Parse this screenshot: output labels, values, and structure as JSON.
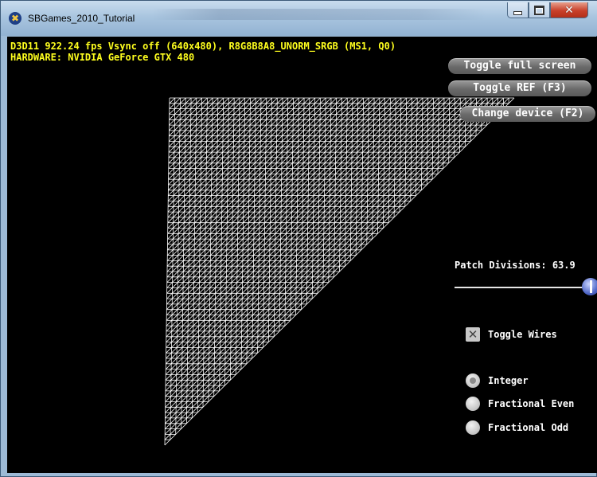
{
  "window": {
    "title": "SBGames_2010_Tutorial",
    "controls": {
      "close_glyph": "✕"
    }
  },
  "hud": {
    "line1": "D3D11 922.24 fps Vsync off (640x480), R8G8B8A8_UNORM_SRGB (MS1, Q0)",
    "line2": "HARDWARE: NVIDIA GeForce GTX 480"
  },
  "buttons": {
    "toggle_full_screen": "Toggle full screen",
    "toggle_ref": "Toggle REF (F3)",
    "change_device": "Change device (F2)"
  },
  "tessellation": {
    "patch_divisions_label": "Patch Divisions: 63.9",
    "slider_fraction": 0.98,
    "toggle_wires_label": "Toggle Wires",
    "toggle_wires_checked": true,
    "partitioning_options": [
      "Integer",
      "Fractional Even",
      "Fractional Odd"
    ],
    "selected_partitioning": "Integer"
  },
  "colors": {
    "hud_text": "#ffff1e",
    "viewport_background": "#000000",
    "wireframe": "#ffffff",
    "slider_thumb": "#4f66c6"
  },
  "icons": {
    "app": "sbgames-app-icon",
    "minimize": "minimize-icon",
    "maximize": "maximize-icon",
    "close": "close-icon",
    "checkbox": "checkbox-x-icon",
    "radio": "radio-button"
  }
}
